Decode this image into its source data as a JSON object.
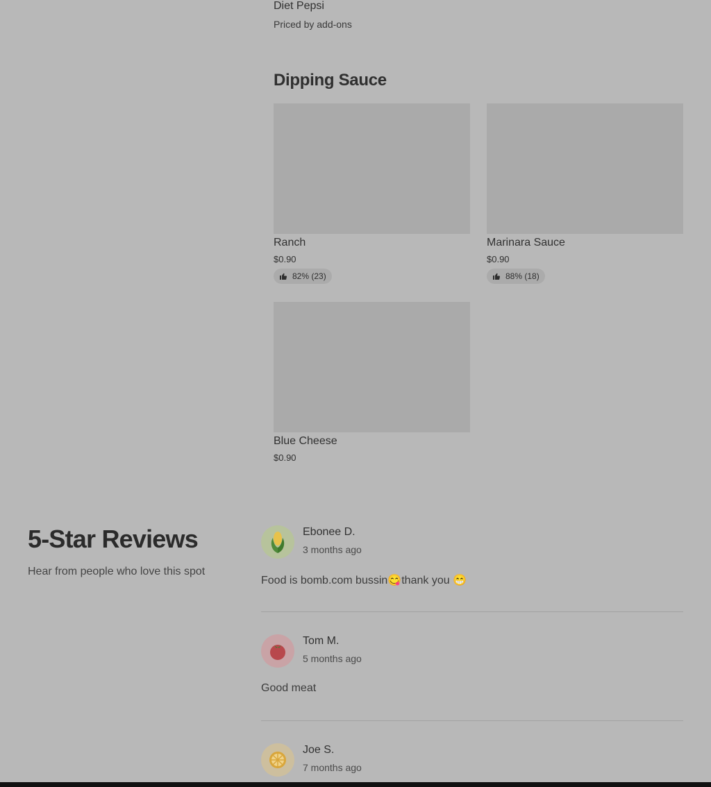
{
  "previous_item": {
    "name": "Diet Pepsi",
    "price_text": "Priced by add-ons"
  },
  "dipping_sauce": {
    "title": "Dipping Sauce",
    "items": [
      {
        "name": "Ranch",
        "price": "$0.90",
        "rating": "82% (23)"
      },
      {
        "name": "Marinara Sauce",
        "price": "$0.90",
        "rating": "88% (18)"
      },
      {
        "name": "Blue Cheese",
        "price": "$0.90"
      }
    ]
  },
  "reviews": {
    "title": "5-Star Reviews",
    "subtitle": "Hear from people who love this spot",
    "items": [
      {
        "name": "Ebonee D.",
        "time": "3 months ago",
        "text": "Food is bomb.com bussin😋thank you 😁",
        "avatar_icon": "corn-icon",
        "avatar_color": "#b7c39c"
      },
      {
        "name": "Tom M.",
        "time": "5 months ago",
        "text": "Good meat",
        "avatar_icon": "tomato-icon",
        "avatar_color": "#c9a3a6"
      },
      {
        "name": "Joe S.",
        "time": "7 months ago",
        "avatar_icon": "lemon-slice-icon",
        "avatar_color": "#cdbf9e"
      }
    ]
  },
  "colors": {
    "background": "#b8b8b8",
    "card_image": "#aaaaaa",
    "bottom_bar": "#111111"
  }
}
